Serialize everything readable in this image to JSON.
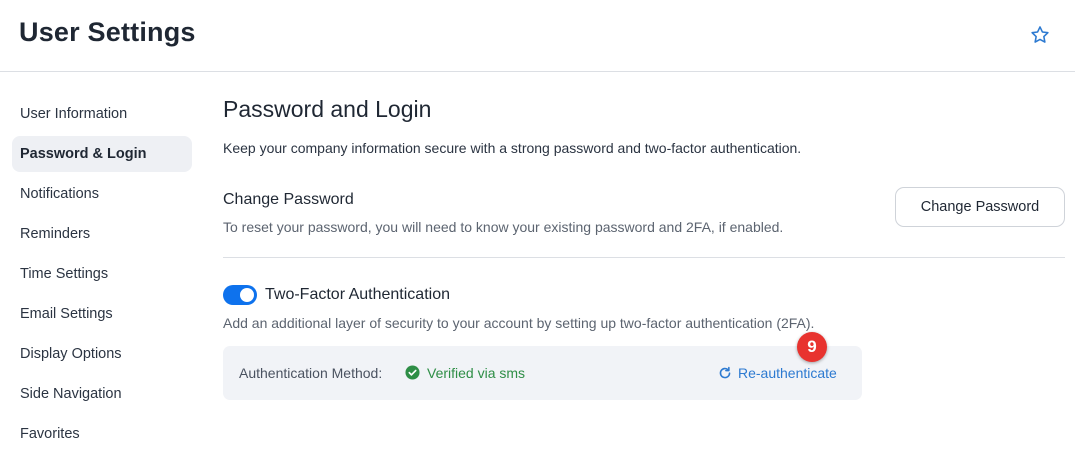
{
  "header": {
    "title": "User Settings",
    "favorite_icon": "star-outline-icon"
  },
  "sidebar": {
    "items": [
      {
        "label": "User Information",
        "active": false
      },
      {
        "label": "Password & Login",
        "active": true
      },
      {
        "label": "Notifications",
        "active": false
      },
      {
        "label": "Reminders",
        "active": false
      },
      {
        "label": "Time Settings",
        "active": false
      },
      {
        "label": "Email Settings",
        "active": false
      },
      {
        "label": "Display Options",
        "active": false
      },
      {
        "label": "Side Navigation",
        "active": false
      },
      {
        "label": "Favorites",
        "active": false
      }
    ]
  },
  "main": {
    "title": "Password and Login",
    "description": "Keep your company information secure with a strong password and two-factor authentication.",
    "change_password": {
      "title": "Change Password",
      "description": "To reset your password, you will need to know your existing password and 2FA, if enabled.",
      "button_label": "Change Password"
    },
    "two_factor": {
      "enabled": true,
      "title": "Two-Factor Authentication",
      "description": "Add an additional layer of security to your account by setting up two-factor authentication (2FA).",
      "method_label": "Authentication Method:",
      "method_value": "Verified via sms",
      "reauth_label": "Re-authenticate"
    }
  },
  "annotation": {
    "badge_number": "9"
  },
  "colors": {
    "accent": "#0e72ed",
    "verified": "#2e8e46",
    "link": "#2d7ad1",
    "badge": "#e8332f"
  }
}
